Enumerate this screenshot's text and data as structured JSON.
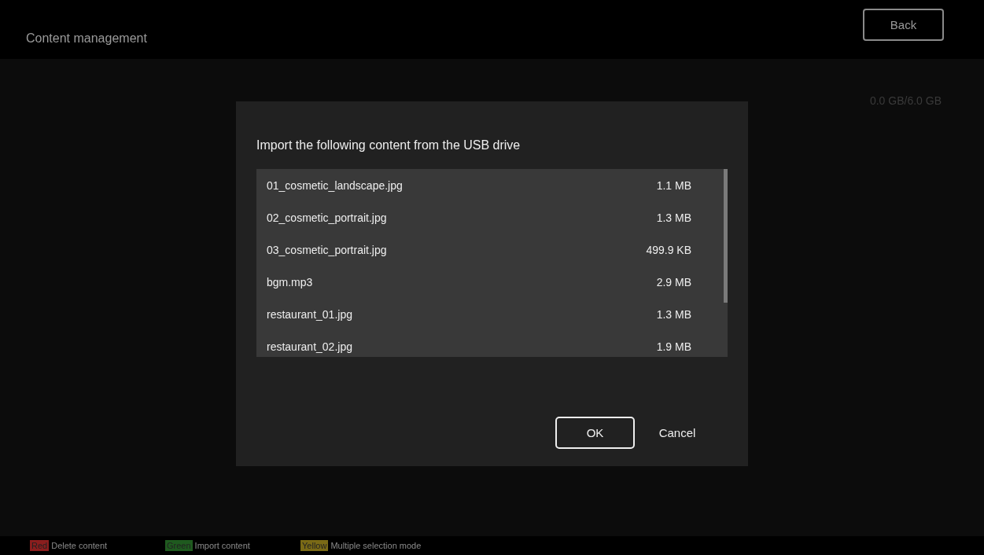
{
  "header": {
    "title": "Content management",
    "back_button": "Back"
  },
  "storage": "0.0 GB/6.0 GB",
  "dialog": {
    "title": "Import the following content from the USB drive",
    "files": [
      {
        "name": "01_cosmetic_landscape.jpg",
        "size": "1.1 MB"
      },
      {
        "name": "02_cosmetic_portrait.jpg",
        "size": "1.3 MB"
      },
      {
        "name": "03_cosmetic_portrait.jpg",
        "size": "499.9 KB"
      },
      {
        "name": "bgm.mp3",
        "size": "2.9 MB"
      },
      {
        "name": "restaurant_01.jpg",
        "size": "1.3 MB"
      },
      {
        "name": "restaurant_02.jpg",
        "size": "1.9 MB"
      }
    ],
    "buttons": [
      {
        "label": "OK",
        "kind": "outlined"
      },
      {
        "label": "Cancel",
        "kind": "plain"
      }
    ]
  },
  "legend": [
    {
      "key": "Red",
      "color": "#8b1e1e",
      "label": "Delete content"
    },
    {
      "key": "Green",
      "color": "#1f5a1f",
      "label": "Import content"
    },
    {
      "key": "Yellow",
      "color": "#7a6a16",
      "label": "Multiple selection mode"
    }
  ]
}
